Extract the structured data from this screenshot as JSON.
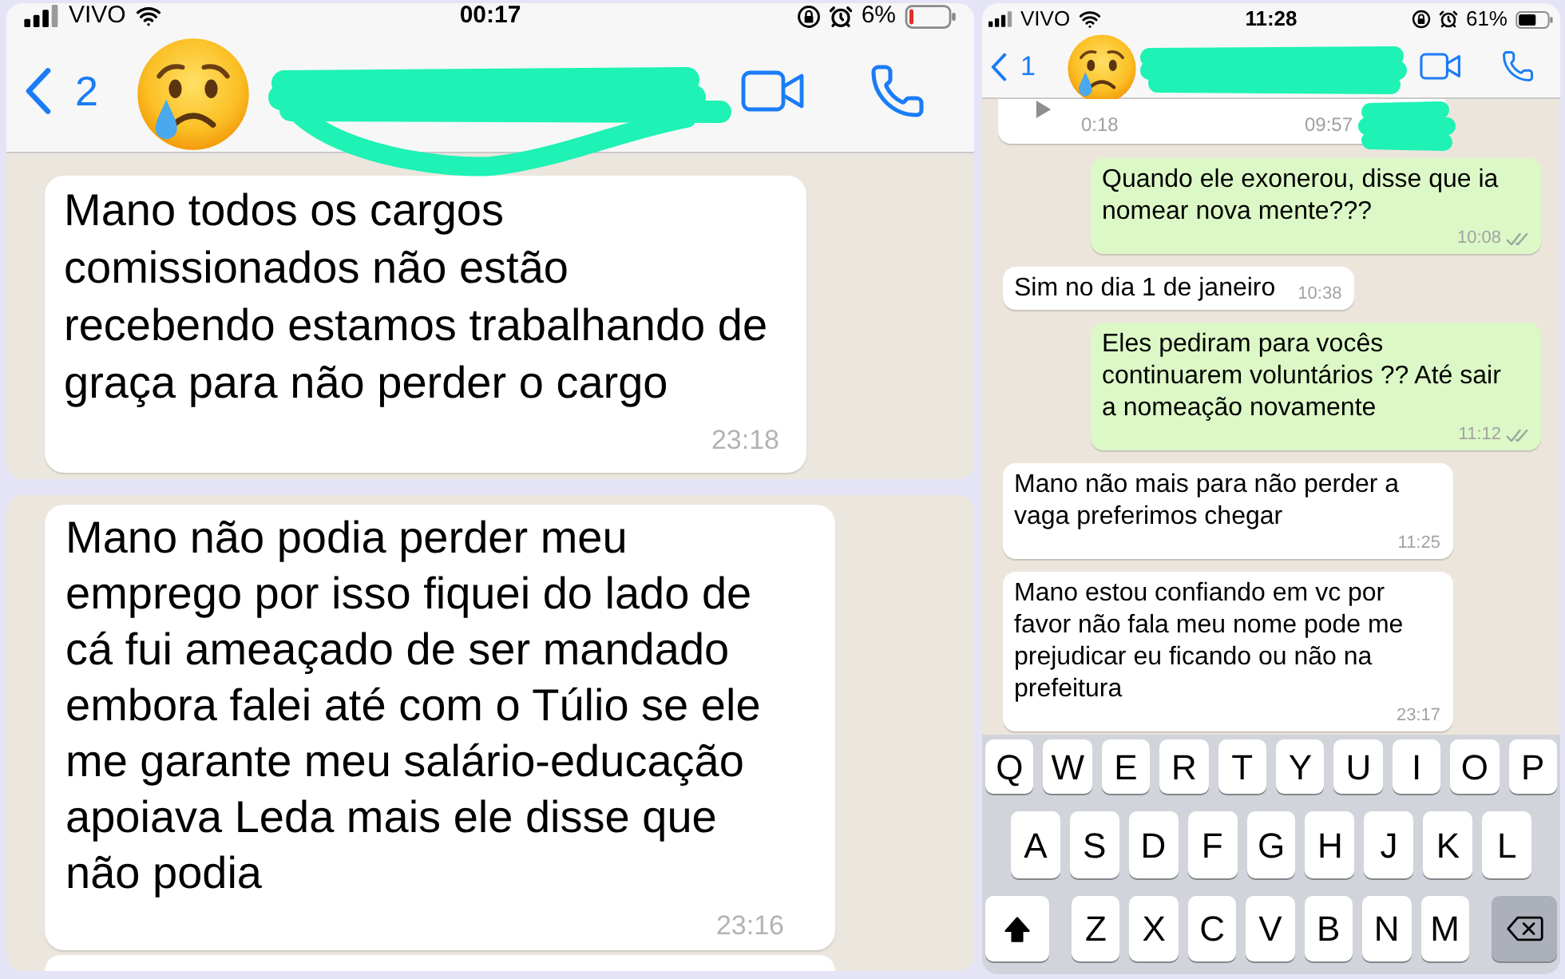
{
  "left_top": {
    "status_bar": {
      "carrier": "VIVO",
      "time": "00:17",
      "battery": "6%"
    },
    "header": {
      "back_count": "2"
    },
    "messages": [
      {
        "kind": "received",
        "text": "Mano todos os cargos comissionados não estão recebendo estamos trabalhando de graça para não perder o cargo",
        "time": "23:18"
      }
    ]
  },
  "left_bottom": {
    "messages": [
      {
        "kind": "received",
        "text": "Mano não podia perder meu emprego por isso fiquei do lado de cá fui ameaçado de ser mandado embora falei até com o Túlio se ele me garante meu salário-educação apoiava Leda mais ele disse que não podia",
        "time": "23:16"
      }
    ]
  },
  "right": {
    "status_bar": {
      "carrier": "VIVO",
      "time": "11:28",
      "battery": "61%"
    },
    "header": {
      "back_count": "1"
    },
    "voice_note": {
      "duration": "0:18",
      "time": "09:57"
    },
    "messages": [
      {
        "kind": "sent",
        "text": "Quando ele exonerou, disse que ia nomear nova mente???",
        "time": "10:08",
        "read": false
      },
      {
        "kind": "received",
        "text": "Sim no dia 1 de janeiro",
        "time": "10:38"
      },
      {
        "kind": "sent",
        "text": "Eles pediram para vocês continuarem voluntários ?? Até sair a nomeação novamente",
        "time": "11:12",
        "read": false
      },
      {
        "kind": "received",
        "text": "Mano não mais para não perder a vaga preferimos chegar",
        "time": "11:25"
      },
      {
        "kind": "received",
        "text": "Mano estou confiando em vc por favor não fala meu nome pode me prejudicar eu ficando ou não na prefeitura",
        "time": "23:17"
      }
    ],
    "keyboard": {
      "shift_on": true,
      "rows": [
        [
          "Q",
          "W",
          "E",
          "R",
          "T",
          "Y",
          "U",
          "I",
          "O",
          "P"
        ],
        [
          "A",
          "S",
          "D",
          "F",
          "G",
          "H",
          "J",
          "K",
          "L"
        ],
        [
          "Z",
          "X",
          "C",
          "V",
          "B",
          "N",
          "M"
        ]
      ]
    }
  }
}
